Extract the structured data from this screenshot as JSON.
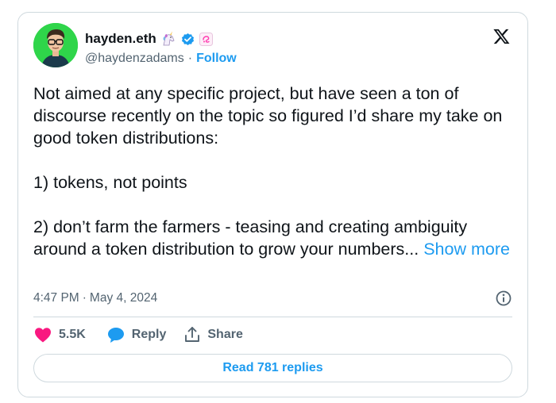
{
  "author": {
    "display_name": "hayden.eth",
    "handle": "@haydenzadams",
    "separator": "·",
    "follow_label": "Follow",
    "avatar_bg": "#2fd54a"
  },
  "tweet": {
    "paragraphs": [
      "Not aimed at any specific project, but have seen a ton of discourse recently on the topic so figured I’d share my take on good token distributions:",
      "1) tokens, not points",
      "2) don’t farm the farmers - teasing and creating ambiguity around a token distribution to grow your numbers..."
    ],
    "show_more_label": "Show more",
    "time": "4:47 PM",
    "date": "May 4, 2024",
    "meta_separator": "·"
  },
  "actions": {
    "likes": "5.5K",
    "reply_label": "Reply",
    "share_label": "Share"
  },
  "read_replies_label": "Read 781 replies",
  "icons": {
    "emoji": "unicorn-icon",
    "verified": "verified-badge-icon",
    "affiliate": "affiliate-badge-icon",
    "logo": "x-logo-icon",
    "info": "info-icon",
    "like": "heart-icon",
    "reply": "reply-bubble-icon",
    "share": "share-icon"
  },
  "colors": {
    "accent": "#1d9bf0",
    "like": "#f91880",
    "text": "#0f1419",
    "secondary": "#536471",
    "border": "#cfd9de"
  }
}
